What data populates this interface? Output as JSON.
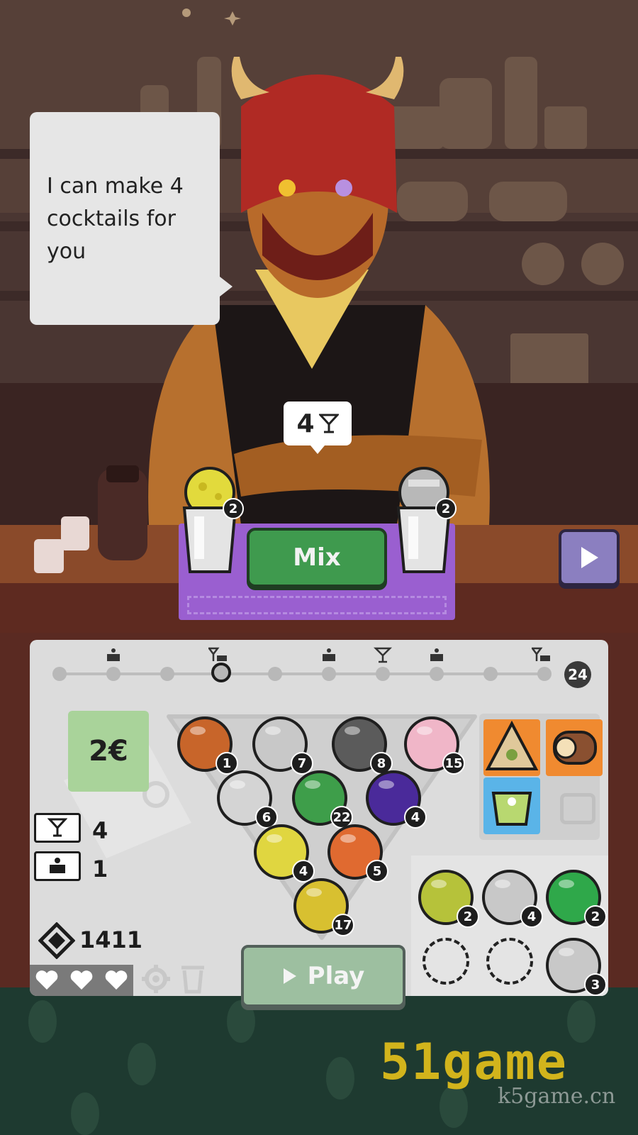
{
  "dialog": {
    "text": "I can make 4 cocktails for you"
  },
  "capacity_bubble": {
    "value": "4",
    "icon": "cocktail-glass-icon"
  },
  "mixer": {
    "left_cup_count": "2",
    "right_cup_count": "2",
    "mix_label": "Mix",
    "next_icon": "play-triangle-icon"
  },
  "progress": {
    "total": "24",
    "icons": [
      "cake-icon",
      "cocktail-cake-icon",
      "cake-icon",
      "cocktail-glass-icon",
      "cake-icon",
      "cocktail-cake-icon"
    ],
    "current_step": 4
  },
  "wallet": {
    "money": "2€",
    "cocktail_tickets": "4",
    "cake_tickets": "1",
    "gems": "1411"
  },
  "rack_balls": [
    {
      "count": "1",
      "color": "#c8652a"
    },
    {
      "count": "7",
      "color": "#c8c8c8"
    },
    {
      "count": "8",
      "color": "#5b5b5b"
    },
    {
      "count": "15",
      "color": "#f0b6c8"
    },
    {
      "count": "6",
      "color": "#d4d4d4"
    },
    {
      "count": "22",
      "color": "#3e9e4a"
    },
    {
      "count": "4",
      "color": "#4a2a9a"
    },
    {
      "count": "4",
      "color": "#e0d640"
    },
    {
      "count": "5",
      "color": "#e06a30"
    },
    {
      "count": "17",
      "color": "#d8c030"
    }
  ],
  "inventory_balls": [
    {
      "count": "2",
      "color": "#b6c23a"
    },
    {
      "count": "4",
      "color": "#c8c8c8"
    },
    {
      "count": "2",
      "color": "#2fa84a"
    },
    {
      "count": "3",
      "color": "#c8c8c8"
    }
  ],
  "snacks": [
    "samosa-icon",
    "swiss-roll-icon",
    "matcha-cup-icon"
  ],
  "play": {
    "label": "Play"
  },
  "bottom": {
    "lives": 3,
    "settings_icon": "gear-icon",
    "trash_icon": "trash-icon"
  },
  "watermark": {
    "brand": "51game",
    "site": "k5game.cn"
  }
}
